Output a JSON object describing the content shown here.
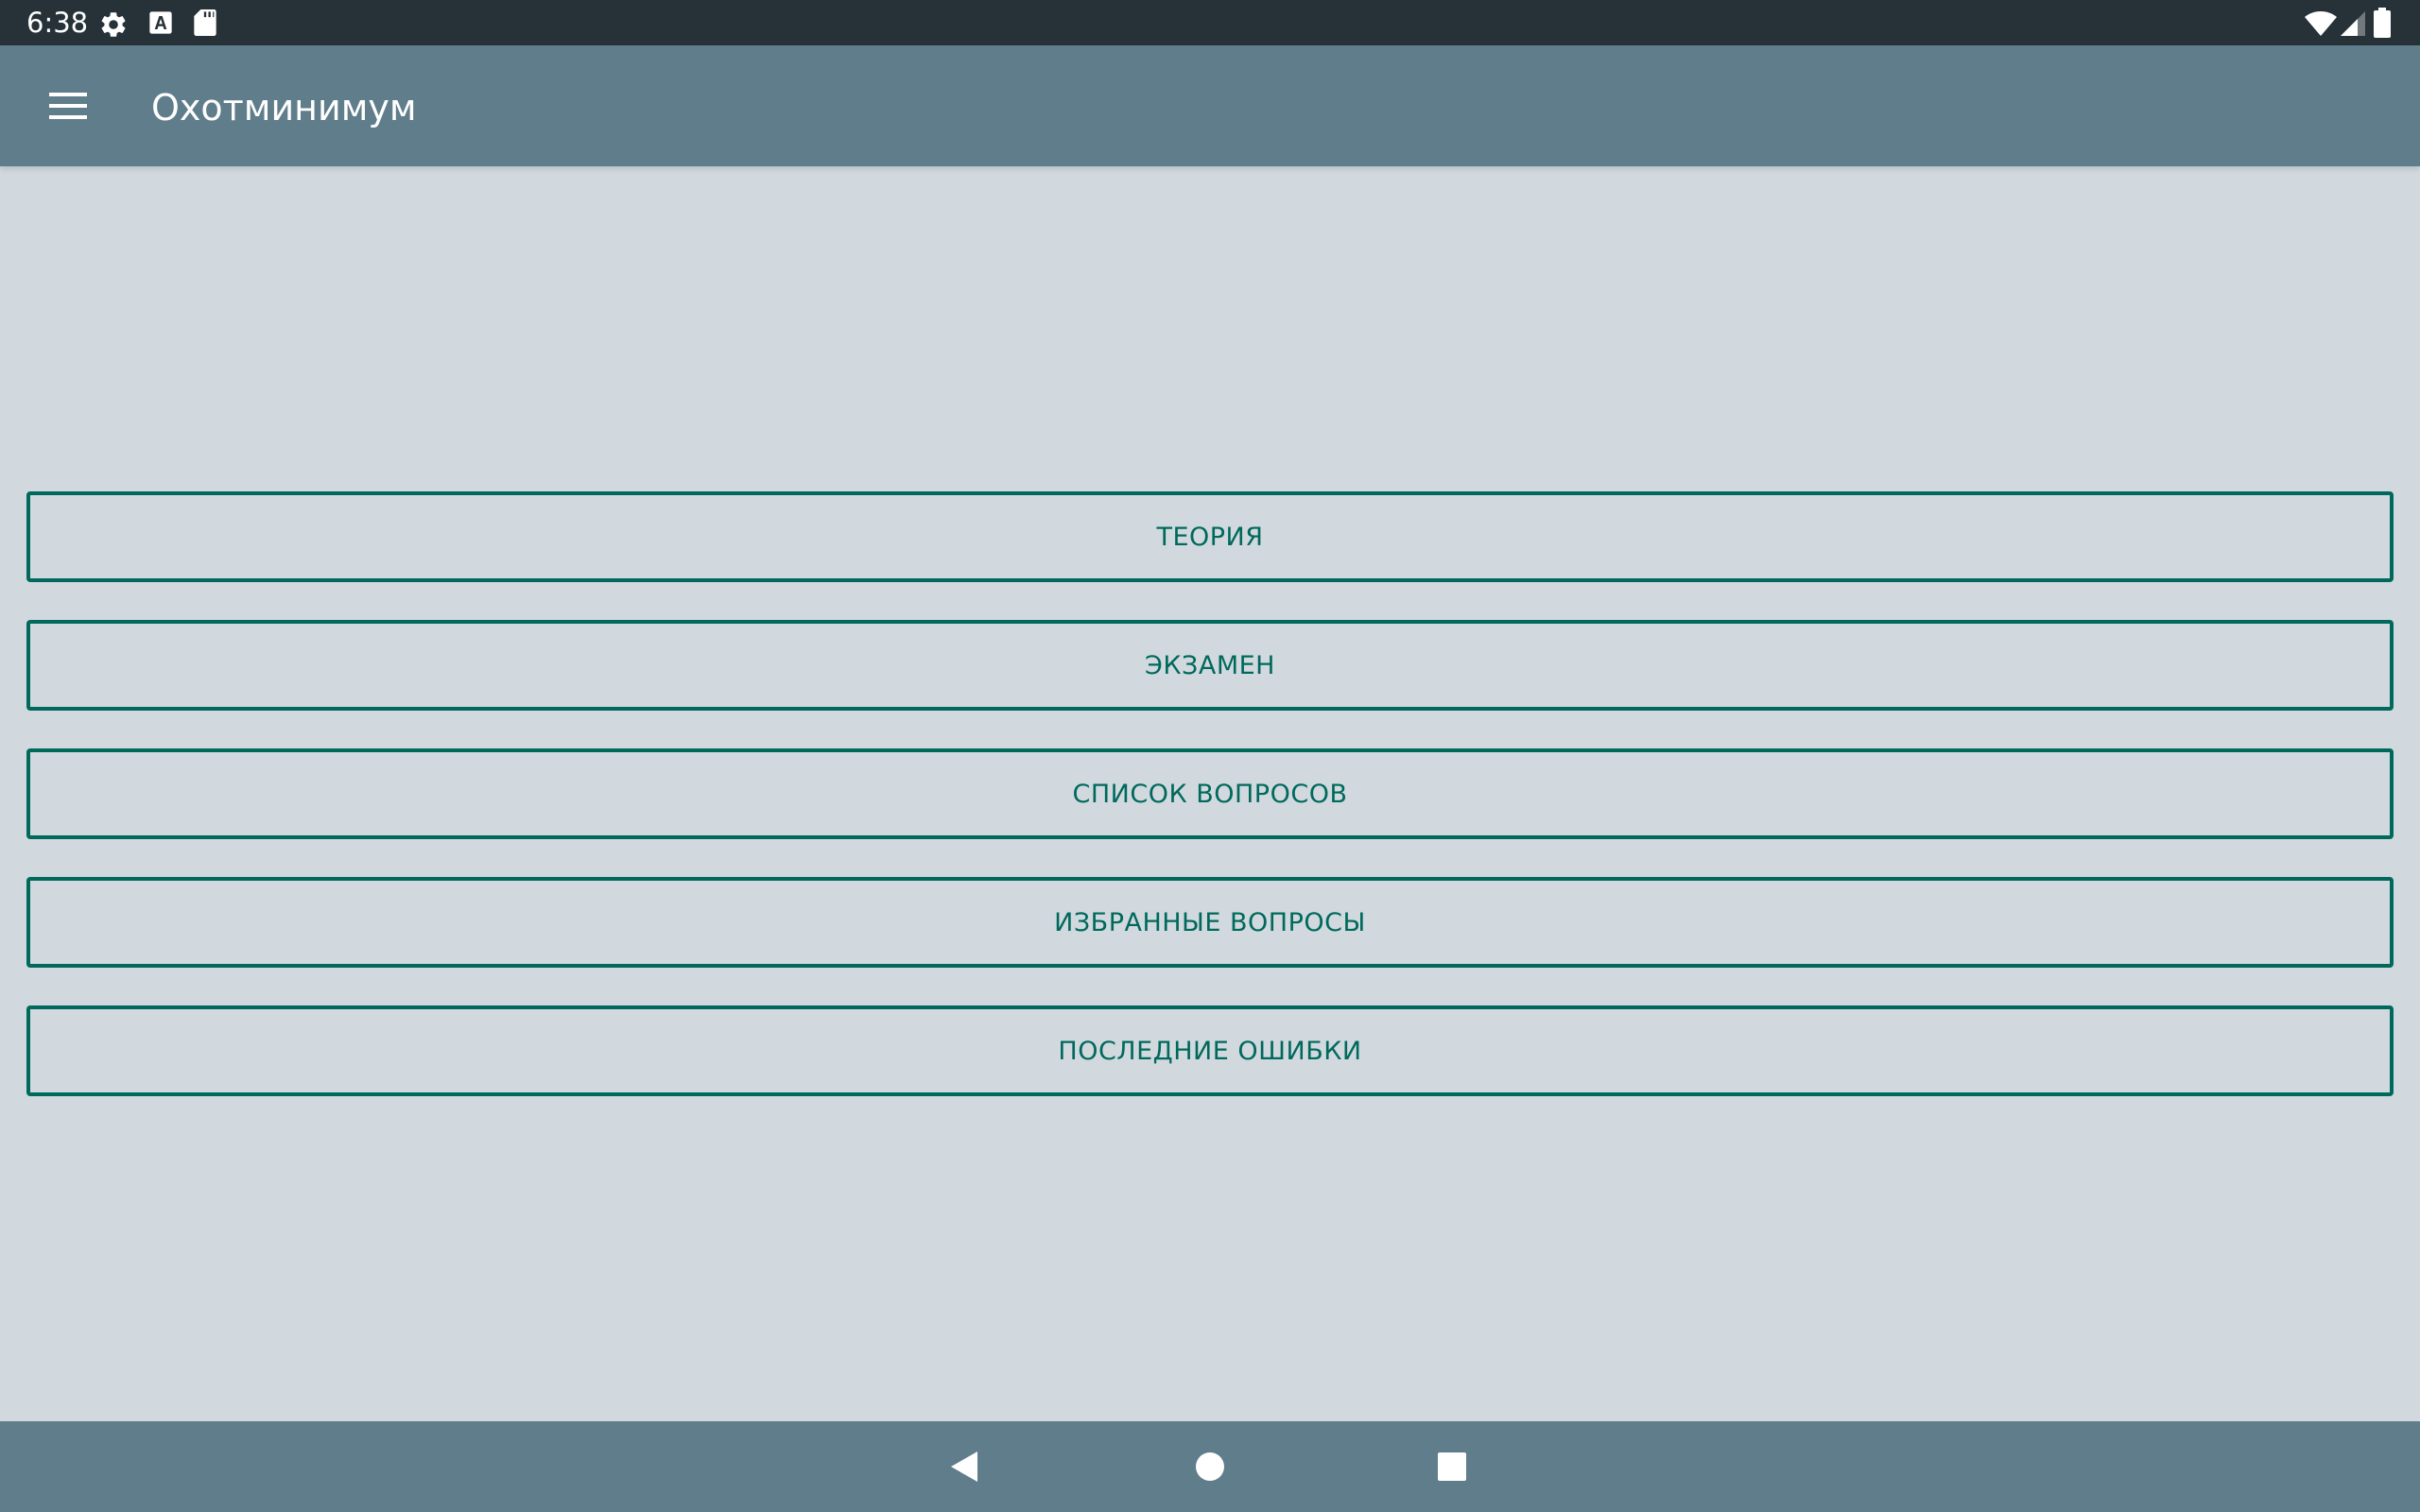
{
  "status_bar": {
    "time": "6:38",
    "icons": [
      "settings-icon",
      "font-a-icon",
      "sd-card-icon",
      "wifi-icon",
      "signal-icon",
      "battery-icon"
    ]
  },
  "app_bar": {
    "title": "Охотминимум",
    "menu_icon": "hamburger-menu-icon"
  },
  "menu": {
    "items": [
      {
        "label": "ТЕОРИЯ"
      },
      {
        "label": "ЭКЗАМЕН"
      },
      {
        "label": "СПИСОК ВОПРОСОВ"
      },
      {
        "label": "ИЗБРАННЫЕ ВОПРОСЫ"
      },
      {
        "label": "ПОСЛЕДНИЕ ОШИБКИ"
      }
    ]
  },
  "navigation_bar": {
    "buttons": [
      "back-icon",
      "home-icon",
      "recents-icon"
    ]
  },
  "colors": {
    "status_bar": "#263238",
    "app_bar": "#607d8b",
    "background": "#d1d9df",
    "accent": "#00695c"
  }
}
